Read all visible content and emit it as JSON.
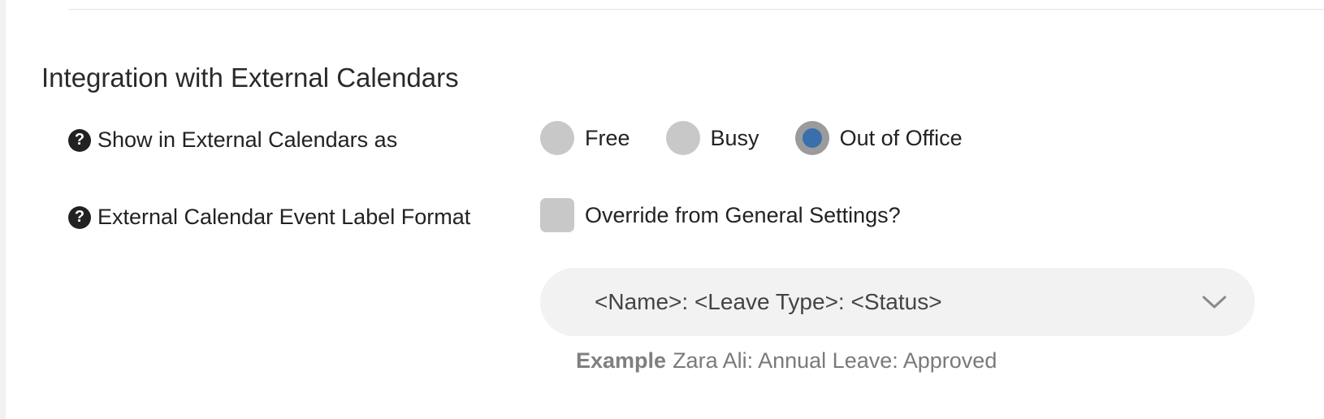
{
  "section": {
    "title": "Integration with External Calendars"
  },
  "show_as": {
    "label": "Show in External Calendars as",
    "icon": "question-circle-icon",
    "options": [
      {
        "label": "Free",
        "selected": false
      },
      {
        "label": "Busy",
        "selected": false
      },
      {
        "label": "Out of Office",
        "selected": true
      }
    ]
  },
  "event_label_format": {
    "label": "External Calendar Event Label Format",
    "icon": "question-circle-icon",
    "override_label": "Override from General Settings?",
    "override_checked": false,
    "select_value": "<Name>: <Leave Type>: <Status>",
    "example_label": "Example",
    "example_value": "Zara Ali: Annual Leave: Approved"
  },
  "colors": {
    "radio_selected_fill": "#3a6fae",
    "control_gray": "#c8c8c8",
    "select_background": "#f2f2f2"
  }
}
